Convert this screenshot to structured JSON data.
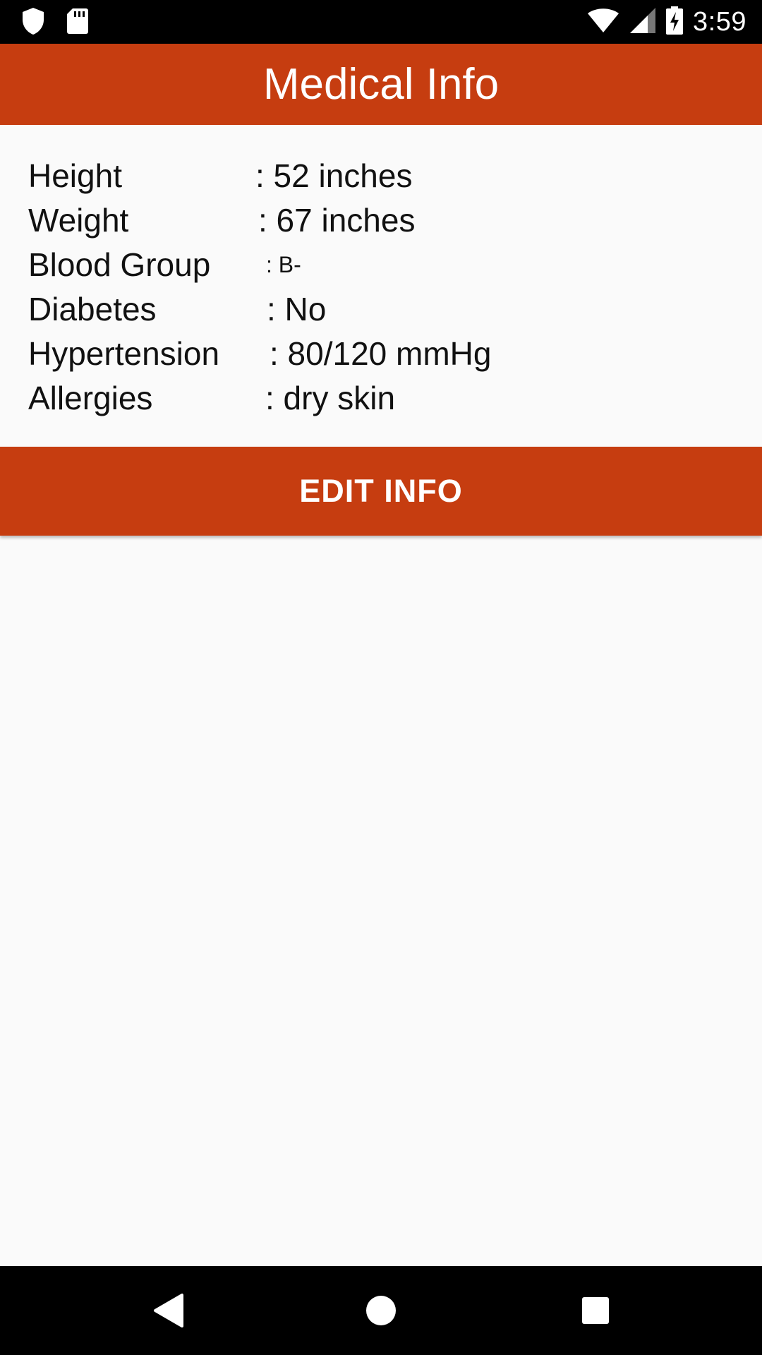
{
  "status_bar": {
    "time": "3:59",
    "icons": [
      "shield-icon",
      "sd-card-icon",
      "wifi-icon",
      "cell-signal-icon",
      "battery-charging-icon"
    ]
  },
  "app_bar": {
    "title": "Medical Info",
    "color": "#c63d10"
  },
  "info": {
    "rows": [
      {
        "label": "Height",
        "value": ": 52 inches"
      },
      {
        "label": "Weight",
        "value": ": 67 inches"
      },
      {
        "label": "Blood Group",
        "value": ": B-"
      },
      {
        "label": "Diabetes",
        "value": ": No"
      },
      {
        "label": "Hypertension",
        "value": ": 80/120 mmHg"
      },
      {
        "label": "Allergies",
        "value": ": dry skin"
      }
    ]
  },
  "edit_button": {
    "label": "EDIT INFO"
  },
  "nav_bar": {
    "icons": [
      "back-icon",
      "home-icon",
      "recents-icon"
    ]
  }
}
